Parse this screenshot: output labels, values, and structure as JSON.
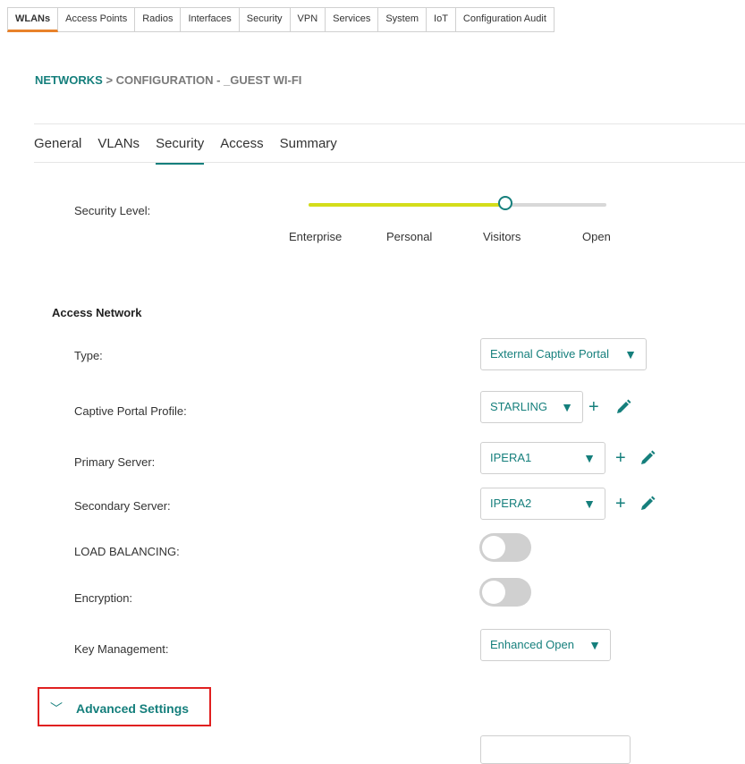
{
  "top_tabs": [
    "WLANs",
    "Access Points",
    "Radios",
    "Interfaces",
    "Security",
    "VPN",
    "Services",
    "System",
    "IoT",
    "Configuration Audit"
  ],
  "breadcrumb": {
    "link": "NETWORKS",
    "rest": " > CONFIGURATION - _GUEST WI-FI"
  },
  "sub_tabs": [
    "General",
    "VLANs",
    "Security",
    "Access",
    "Summary"
  ],
  "security_level": {
    "label": "Security Level:",
    "levels": [
      "Enterprise",
      "Personal",
      "Visitors",
      "Open"
    ],
    "selected": "Visitors",
    "fill_fraction": 0.66,
    "colors": {
      "fill": "#d4dd1a",
      "thumb": "#157f7c"
    }
  },
  "access_network": {
    "title": "Access Network",
    "type": {
      "label": "Type:",
      "value": "External Captive Portal"
    },
    "captive_portal_profile": {
      "label": "Captive Portal Profile:",
      "value": "STARLING"
    },
    "primary_server": {
      "label": "Primary Server:",
      "value": "IPERA1"
    },
    "secondary_server": {
      "label": "Secondary Server:",
      "value": "IPERA2"
    },
    "load_balancing": {
      "label": "LOAD BALANCING:",
      "enabled": false
    },
    "encryption": {
      "label": "Encryption:",
      "enabled": false
    },
    "key_management": {
      "label": "Key Management:",
      "value": "Enhanced Open"
    }
  },
  "advanced_settings": {
    "label": "Advanced Settings"
  },
  "icons": {
    "caret": "caret-down-icon",
    "add": "plus-icon",
    "edit": "pencil-icon",
    "chevron": "chevron-down-icon"
  },
  "accent_color": "#157f7c"
}
